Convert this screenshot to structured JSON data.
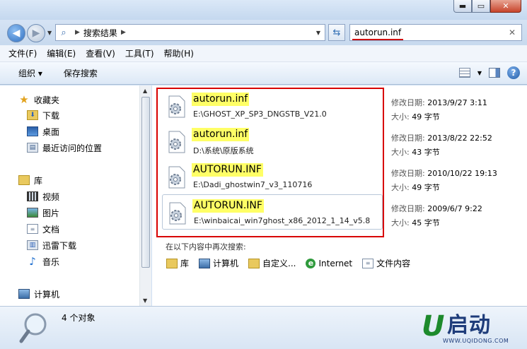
{
  "window": {
    "min_glyph": "▬",
    "max_glyph": "▭",
    "close_glyph": "✕"
  },
  "address": {
    "crumb": "搜索结果",
    "search_value": "autorun.inf",
    "clear_glyph": "✕"
  },
  "menu": [
    "文件(F)",
    "编辑(E)",
    "查看(V)",
    "工具(T)",
    "帮助(H)"
  ],
  "toolbar": {
    "organize": "组织 ▾",
    "save_search": "保存搜索"
  },
  "nav": {
    "favorites": "收藏夹",
    "downloads": "下载",
    "desktop": "桌面",
    "recent": "最近访问的位置",
    "libraries": "库",
    "videos": "视频",
    "pictures": "图片",
    "documents": "文档",
    "thunder": "迅雷下载",
    "music": "音乐",
    "computer": "计算机"
  },
  "results": [
    {
      "name": "autorun.inf",
      "path": "E:\\GHOST_XP_SP3_DNGSTB_V21.0",
      "modified_label": "修改日期:",
      "modified": "2013/9/27 3:11",
      "size_label": "大小:",
      "size": "49 字节"
    },
    {
      "name": "autorun.inf",
      "path": "D:\\系统\\原版系统",
      "modified_label": "修改日期:",
      "modified": "2013/8/22 22:52",
      "size_label": "大小:",
      "size": "43 字节"
    },
    {
      "name": "AUTORUN.INF",
      "path": "E:\\Dadi_ghostwin7_v3_110716",
      "modified_label": "修改日期:",
      "modified": "2010/10/22 19:13",
      "size_label": "大小:",
      "size": "49 字节"
    },
    {
      "name": "AUTORUN.INF",
      "path": "E:\\winbaicai_win7ghost_x86_2012_1_14_v5.8",
      "modified_label": "修改日期:",
      "modified": "2009/6/7 9:22",
      "size_label": "大小:",
      "size": "45 字节"
    }
  ],
  "search_again": {
    "label": "在以下内容中再次搜索:",
    "options": [
      "库",
      "计算机",
      "自定义...",
      "Internet",
      "文件内容"
    ]
  },
  "details": {
    "count": "4 个对象"
  },
  "logo": {
    "u": "U",
    "name": "启动",
    "url": "WWW.UQIDONG.COM"
  }
}
